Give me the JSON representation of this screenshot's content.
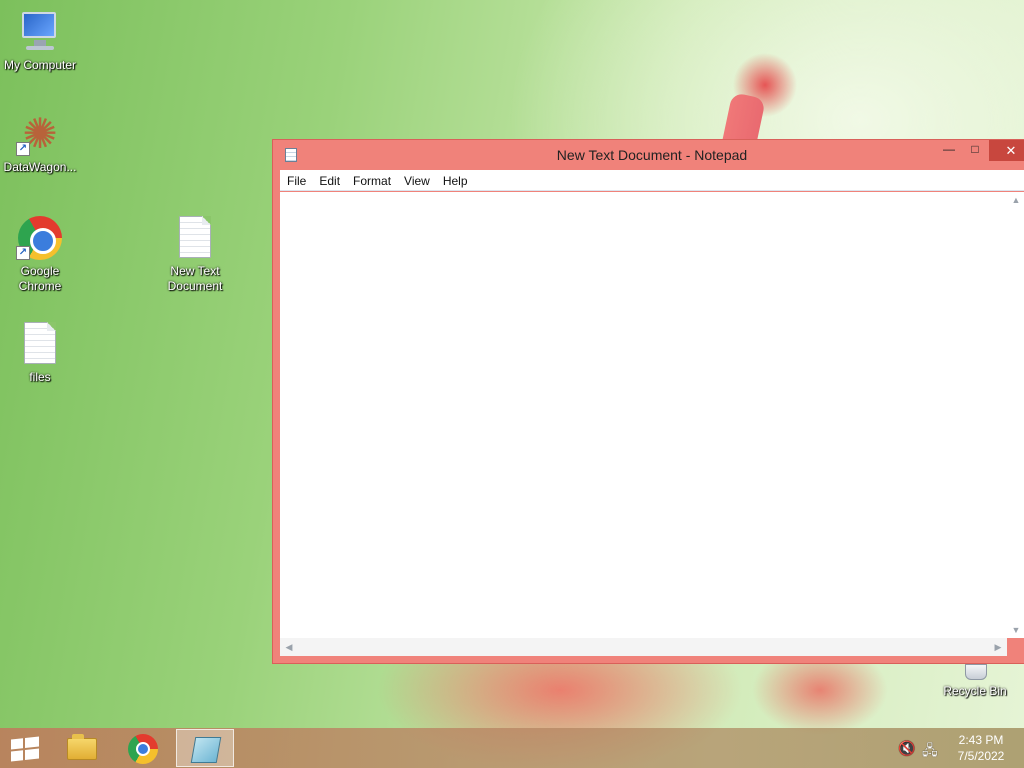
{
  "desktop": {
    "icons": [
      {
        "label": "My Computer",
        "icon": "computer-icon"
      },
      {
        "label": "DataWagon...",
        "icon": "datawagon-icon"
      },
      {
        "label": "Google Chrome",
        "icon": "chrome-icon"
      },
      {
        "label": "New Text Document",
        "icon": "text-document-icon"
      },
      {
        "label": "files",
        "icon": "text-document-icon"
      },
      {
        "label": "Recycle Bin",
        "icon": "recycle-bin-icon"
      }
    ]
  },
  "notepad": {
    "title": "New Text Document - Notepad",
    "menu": [
      "File",
      "Edit",
      "Format",
      "View",
      "Help"
    ],
    "content": "",
    "controls": {
      "minimize": "—",
      "maximize": "□",
      "close": "✕"
    }
  },
  "taskbar": {
    "items": [
      {
        "name": "start",
        "icon": "windows-start-icon"
      },
      {
        "name": "file-explorer",
        "icon": "folder-icon"
      },
      {
        "name": "chrome",
        "icon": "chrome-icon"
      },
      {
        "name": "notepad",
        "icon": "notepad-icon",
        "active": true
      }
    ],
    "tray": {
      "time": "2:43 PM",
      "date": "7/5/2022",
      "speaker": "🔇",
      "network": "🖧"
    }
  }
}
